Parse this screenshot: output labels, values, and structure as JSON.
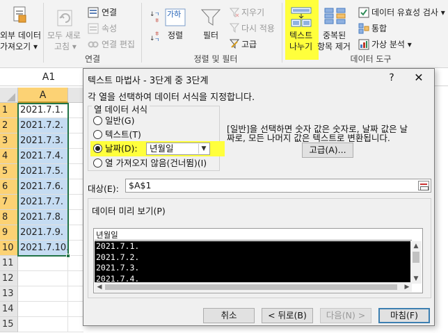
{
  "ribbon": {
    "get_external_data": [
      "외부 데이터",
      "가져오기 ▾"
    ],
    "refresh_all": [
      "모두 새로",
      "고침 ▾"
    ],
    "connections": "연결",
    "properties": "속성",
    "edit_links": "연결 편집",
    "connections_group": "연결",
    "sort": "정렬",
    "sort_az_icon_text": "가하",
    "filter": "필터",
    "clear": "지우기",
    "reapply": "다시 적용",
    "advanced": "고급",
    "sort_filter_group": "정렬 및 필터",
    "text_to_columns": [
      "텍스트",
      "나누기"
    ],
    "remove_duplicates": [
      "중복된",
      "항목 제거"
    ],
    "data_validation": "데이터 유효성 검사 ▾",
    "consolidate": "통합",
    "what_if": "가상 분석 ▾",
    "data_tools_group": "데이터 도구",
    "accent_highlight": "#ffff3c"
  },
  "namebox": "A1",
  "sheet": {
    "column_header": "A",
    "row_numbers": [
      "1",
      "2",
      "3",
      "4",
      "5",
      "6",
      "7",
      "8",
      "9",
      "10",
      "11",
      "12",
      "13",
      "14",
      "15"
    ],
    "cells": [
      "2021.7.1.",
      "2021.7.2.",
      "2021.7.3.",
      "2021.7.4.",
      "2021.7.5.",
      "2021.7.6.",
      "2021.7.7.",
      "2021.7.8.",
      "2021.7.9.",
      "2021.7.10."
    ]
  },
  "dialog": {
    "title": "텍스트 마법사 - 3단계 중 3단계",
    "help": "?",
    "close": "✕",
    "instruction": "각 열을 선택하여 데이터 서식을 지정합니다.",
    "column_format_legend": "열 데이터 서식",
    "radio_general": "일반(G)",
    "radio_text": "텍스트(T)",
    "radio_date": "날짜(D):",
    "radio_skip": "열 가져오지 않음(건너뜀)(I)",
    "date_format": "년월일",
    "description": "[일반]을 선택하면 숫자 값은 숫자로, 날짜 값은 날짜로, 모든 나머지 값은 텍스트로 변환됩니다.",
    "advanced_button": "고급(A)...",
    "destination_label": "대상(E):",
    "destination_value": "$A$1",
    "preview_label": "데이터 미리 보기(P)",
    "preview_header": "년월일",
    "preview_lines": [
      "2021.7.1.",
      "2021.7.2.",
      "2021.7.3.",
      "2021.7.4."
    ],
    "cancel": "취소",
    "back": "< 뒤로(B)",
    "next": "다음(N) >",
    "finish": "마침(F)"
  }
}
